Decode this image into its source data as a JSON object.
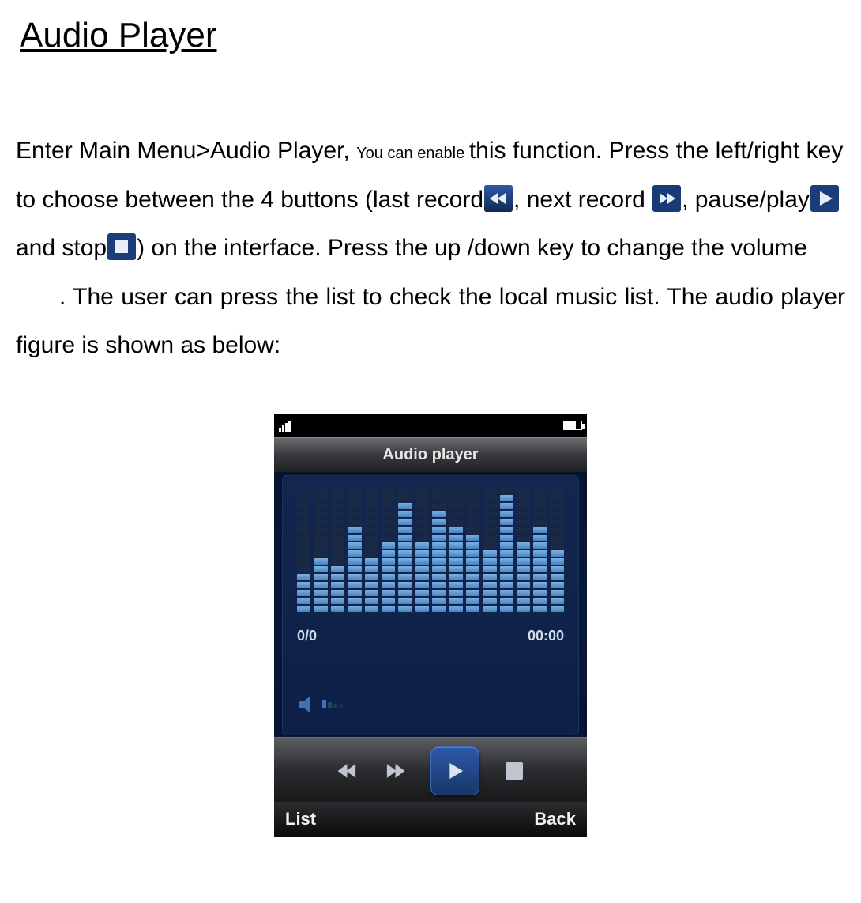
{
  "heading": "Audio Player",
  "para1": {
    "t1": "Enter Main Menu>Audio Player, ",
    "t1_small": "You can enable ",
    "t2": "this function. Press the left/right key to choose between the 4 buttons (last record",
    "t3": ", next record",
    "t4": ", pause/play",
    "t5": " and stop",
    "t6": ") on the interface. Press the up /down key to change the volume"
  },
  "para2": ". The user can press the list to check the local music list. The audio player figure is shown as below:",
  "phone": {
    "title": "Audio player",
    "track_index": "0/0",
    "elapsed": "00:00",
    "soft_left": "List",
    "soft_right": "Back"
  },
  "eq_bars": [
    5,
    7,
    6,
    11,
    7,
    9,
    14,
    9,
    13,
    11,
    10,
    8,
    15,
    9,
    11,
    8
  ],
  "eq_max": 16
}
